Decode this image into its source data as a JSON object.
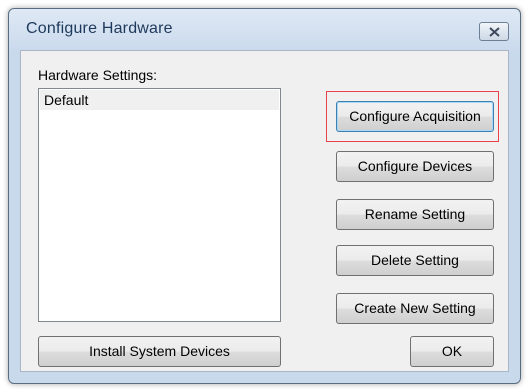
{
  "window": {
    "title": "Configure Hardware",
    "close_icon": "close-icon"
  },
  "settings": {
    "label": "Hardware Settings:",
    "items": [
      "Default"
    ],
    "selected": "Default"
  },
  "buttons": {
    "configure_acquisition": "Configure Acquisition",
    "configure_devices": "Configure Devices",
    "rename_setting": "Rename Setting",
    "delete_setting": "Delete Setting",
    "create_new_setting": "Create New Setting",
    "install_system_devices": "Install System Devices",
    "ok": "OK"
  },
  "colors": {
    "highlight": "#e8434b",
    "title_text": "#1e395b"
  }
}
